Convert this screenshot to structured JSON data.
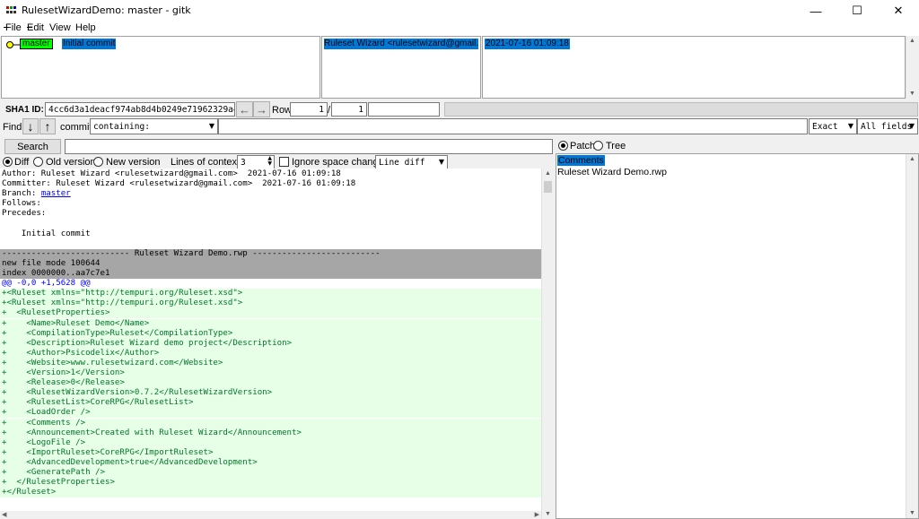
{
  "window": {
    "title": "RulesetWizardDemo: master - gitk",
    "minimize": "—",
    "maximize": "☐",
    "close": "✕"
  },
  "menu": [
    "File",
    "Edit",
    "View",
    "Help"
  ],
  "commit_list": {
    "branch": "master",
    "message": "Initial commit",
    "author": "Ruleset Wizard <rulesetwizard@gmail.com>",
    "date": "2021-07-16 01:09:18"
  },
  "sha_bar": {
    "label": "SHA1 ID:",
    "sha": "4cc6d3a1deacf974ab8d4b0249e71962329a45fb",
    "back": "←",
    "forward": "→",
    "row_label": "Row",
    "row": "1",
    "sep": "/",
    "total": "1"
  },
  "find_bar": {
    "label": "Find",
    "down": "↓",
    "up": "↑",
    "commit_label": "commit",
    "mode": "containing:",
    "match": "Exact",
    "fields": "All fields"
  },
  "search": {
    "button": "Search"
  },
  "diff_options": {
    "diff": "Diff",
    "old": "Old version",
    "new": "New version",
    "context_label": "Lines of context:",
    "context": "3",
    "ignore_space": "Ignore space change",
    "diff_mode": "Line diff"
  },
  "tree_options": {
    "patch": "Patch",
    "tree": "Tree"
  },
  "files": {
    "comments": "Comments",
    "file": "Ruleset Wizard Demo.rwp"
  },
  "diff_lines": [
    {
      "t": "Author: Ruleset Wizard <rulesetwizard@gmail.com>  2021-07-16 01:09:18",
      "k": "meta"
    },
    {
      "t": "Committer: Ruleset Wizard <rulesetwizard@gmail.com>  2021-07-16 01:09:18",
      "k": "meta"
    },
    {
      "t": "Branch: ",
      "k": "branch",
      "link": "master"
    },
    {
      "t": "Follows:",
      "k": "meta"
    },
    {
      "t": "Precedes:",
      "k": "meta"
    },
    {
      "t": "",
      "k": "meta"
    },
    {
      "t": "    Initial commit",
      "k": "meta"
    },
    {
      "t": "",
      "k": "meta"
    },
    {
      "t": "-------------------------- Ruleset Wizard Demo.rwp --------------------------",
      "k": "hdr"
    },
    {
      "t": "new file mode 100644",
      "k": "hdr"
    },
    {
      "t": "index 0000000..aa7c7e1",
      "k": "hdr"
    },
    {
      "t": "@@ -0,0 +1,5628 @@",
      "k": "hunk"
    },
    {
      "t": "+<Ruleset xmlns=\"http://tempuri.org/Ruleset.xsd\">",
      "k": "add"
    },
    {
      "t": "+<Ruleset xmlns=\"http://tempuri.org/Ruleset.xsd\">",
      "k": "add"
    },
    {
      "t": "+  <RulesetProperties>",
      "k": "add"
    },
    {
      "t": "+    <Name>Ruleset Demo</Name>",
      "k": "add"
    },
    {
      "t": "+    <CompilationType>Ruleset</CompilationType>",
      "k": "add"
    },
    {
      "t": "+    <Description>Ruleset Wizard demo project</Description>",
      "k": "add"
    },
    {
      "t": "+    <Author>Psicodelix</Author>",
      "k": "add"
    },
    {
      "t": "+    <Website>www.rulesetwizard.com</Website>",
      "k": "add"
    },
    {
      "t": "+    <Version>1</Version>",
      "k": "add"
    },
    {
      "t": "+    <Release>0</Release>",
      "k": "add"
    },
    {
      "t": "+    <RulesetWizardVersion>0.7.2</RulesetWizardVersion>",
      "k": "add"
    },
    {
      "t": "+    <RulesetList>CoreRPG</RulesetList>",
      "k": "add"
    },
    {
      "t": "+    <LoadOrder />",
      "k": "add"
    },
    {
      "t": "+    <Comments />",
      "k": "add"
    },
    {
      "t": "+    <Announcement>Created with Ruleset Wizard</Announcement>",
      "k": "add"
    },
    {
      "t": "+    <LogoFile />",
      "k": "add"
    },
    {
      "t": "+    <ImportRuleset>CoreRPG</ImportRuleset>",
      "k": "add"
    },
    {
      "t": "+    <AdvancedDevelopment>true</AdvancedDevelopment>",
      "k": "add"
    },
    {
      "t": "+    <GeneratePath />",
      "k": "add"
    },
    {
      "t": "+  </RulesetProperties>",
      "k": "add"
    },
    {
      "t": "+</Ruleset>",
      "k": "add"
    }
  ],
  "colors": {
    "selection": "#0078d7",
    "branch_tag": "#00ff00",
    "added_text": "#00772a",
    "added_bg": "#e6ffe6",
    "header_bg": "#a6a6a6"
  }
}
